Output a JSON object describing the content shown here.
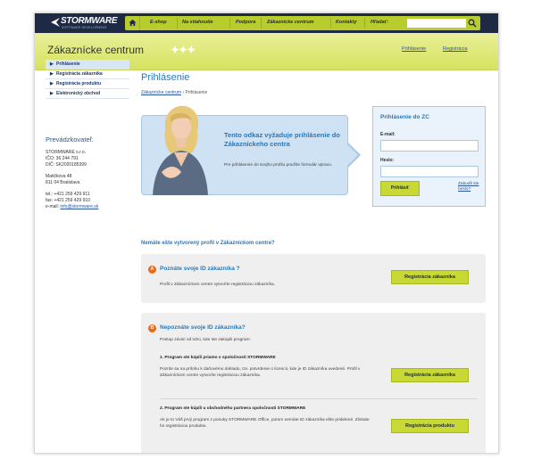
{
  "colors": {
    "nav_bg": "#1e2a44",
    "accent_green": "#c8d936",
    "accent_blue": "#2a78b8",
    "badge_orange": "#e76a1c"
  },
  "nav": {
    "logo": "STORMWARE",
    "logo_tagline": "SOFTWARE DEVELOPMENT",
    "items": [
      "E-shop",
      "Na stiahnutie",
      "Podpora",
      "Zákaznícke centrum",
      "Kontakty",
      "Hľadať:"
    ],
    "search_value": "",
    "home_icon": "home-icon",
    "search_icon": "search-icon"
  },
  "header": {
    "title": "Zákaznícke centrum",
    "links": [
      "Prihlásenie",
      "Registrácia"
    ]
  },
  "sidebar": {
    "items": [
      {
        "label": "Prihlásenie",
        "active": true
      },
      {
        "label": "Registrácia zákazníka",
        "active": false
      },
      {
        "label": "Registrácia produktu",
        "active": false
      },
      {
        "label": "Elektronický obchod",
        "active": false
      }
    ]
  },
  "operator": {
    "title": "Prevádzkovateľ:",
    "company": "STORMWARE s.r.o.",
    "ico": "IČO: 36 244 791",
    "dic": "DIČ: SK2020185399",
    "street": "Matičkova 48",
    "city": "811 04 Bratislava",
    "tel": "tel.: +421 259 429 911",
    "fax": "fax: +421 259 429 910",
    "email_label": "e-mail: ",
    "email": "info@stormware.sk"
  },
  "main": {
    "title": "Prihlásenie",
    "breadcrumb_root": "Zákaznícke centrum",
    "breadcrumb_sep": " › ",
    "breadcrumb_current": "Prihlásenie",
    "info_heading": "Tento odkaz vyžaduje prihlásenie do Zákazníckeho centra",
    "info_text": "Pre prihlásenie do svojho profilu použite formulár vpravo."
  },
  "login": {
    "title": "Prihlásenie do ZC",
    "email_label": "E-mail:",
    "email_value": "",
    "password_label": "Heslo:",
    "password_value": "",
    "submit": "Prihlásiť",
    "forgot": "Zabudli ste heslo?"
  },
  "profile": {
    "question": "Nemáte ešte vytvorený profil v Zákazníckom centre?",
    "a": {
      "badge": "A",
      "title": "Poznáte svoje ID zákazníka ?",
      "text": "Profil v Zákazníckom centre vytvoríte registráciou zákazníka.",
      "button": "Registrácia zákazníka"
    },
    "b": {
      "badge": "B",
      "title": "Nepoznáte svoje ID zákazníka?",
      "intro": "Postup závisí od toho, kde ste zakúpili program:",
      "opt1_title": "1. Program ste kúpili priamo v spoločnosti STORMWARE",
      "opt1_text": "Pozrite sa na prílohu k daňovému dokladu, tzv. potvrdenie o licencii, kde je ID zákazníka uvedené. Profil v Zákazníckom centre vytvoríte registráciou zákazníka.",
      "opt1_button": "Registrácia zákazníka",
      "opt2_title": "2. Program ste kúpili u obchodného partnera spoločnosti STORMWARE",
      "opt2_text": "Ak je to Váš prvý program z ponuky STORMWARE Office, potom nemáte ID zákazníka ešte pridelené. Získate ho registráciou produktu.",
      "opt2_button": "Registrácia produktu"
    }
  }
}
